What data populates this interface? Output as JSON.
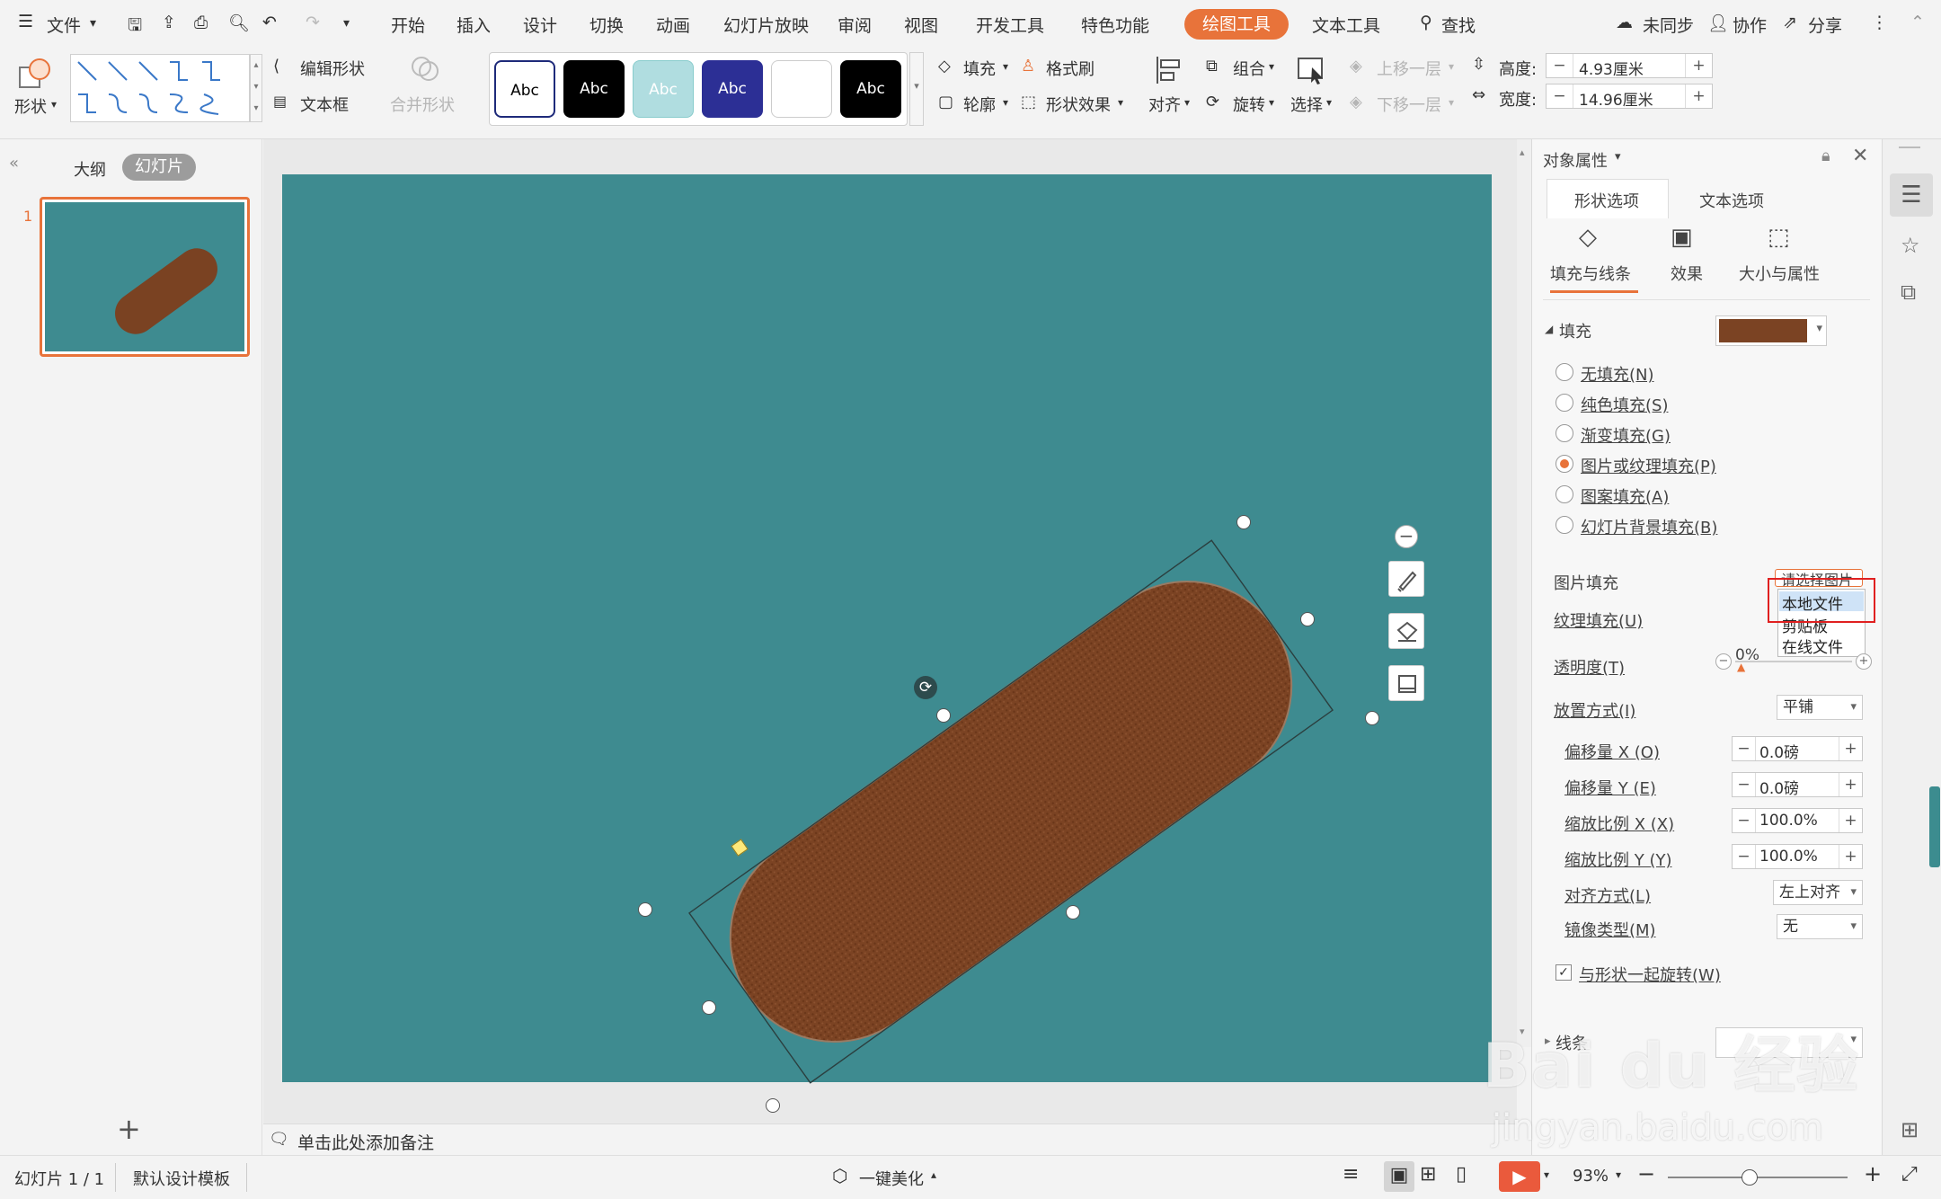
{
  "menubar": {
    "file": "文件",
    "tabs": [
      "开始",
      "插入",
      "设计",
      "切换",
      "动画",
      "幻灯片放映",
      "审阅",
      "视图",
      "开发工具",
      "特色功能"
    ],
    "active_tab": "绘图工具",
    "text_tools": "文本工具",
    "search": "查找",
    "sync": "未同步",
    "collab": "协作",
    "share": "分享"
  },
  "ribbon": {
    "shape": "形状",
    "edit_shape": "编辑形状",
    "text_box": "文本框",
    "merge_shape": "合并形状",
    "style_label": "Abc",
    "fill": "填充",
    "format_brush": "格式刷",
    "outline": "轮廓",
    "shape_effect": "形状效果",
    "align": "对齐",
    "group": "组合",
    "rotate": "旋转",
    "select": "选择",
    "up_layer": "上移一层",
    "down_layer": "下移一层",
    "height_label": "高度:",
    "height_value": "4.93厘米",
    "width_label": "宽度:",
    "width_value": "14.96厘米"
  },
  "left_panel": {
    "tab_outline": "大纲",
    "tab_slides": "幻灯片",
    "slide_number": "1"
  },
  "notes_hint": "单击此处添加备注",
  "right_panel": {
    "title": "对象属性",
    "tab_shape": "形状选项",
    "tab_text": "文本选项",
    "sub_fill": "填充与线条",
    "sub_effect": "效果",
    "sub_size": "大小与属性",
    "fill_section": "填充",
    "options": [
      "无填充(N)",
      "纯色填充(S)",
      "渐变填充(G)",
      "图片或纹理填充(P)",
      "图案填充(A)",
      "幻灯片背景填充(B)"
    ],
    "selected_option": "图片或纹理填充(P)",
    "picture_fill": "图片填充",
    "picture_fill_value": "请选择图片",
    "dropdown_items": [
      "本地文件",
      "剪贴板",
      "在线文件"
    ],
    "texture_fill": "纹理填充(U)",
    "transparency": "透明度(T)",
    "transparency_value": "0%",
    "placement": "放置方式(I)",
    "placement_value": "平铺",
    "offset_x": "偏移量 X (O)",
    "offset_x_value": "0.0磅",
    "offset_y": "偏移量 Y (E)",
    "offset_y_value": "0.0磅",
    "scale_x": "缩放比例 X (X)",
    "scale_x_value": "100.0%",
    "scale_y": "缩放比例 Y (Y)",
    "scale_y_value": "100.0%",
    "alignment": "对齐方式(L)",
    "alignment_value": "左上对齐",
    "mirror": "镜像类型(M)",
    "mirror_value": "无",
    "rotate_with_shape": "与形状一起旋转(W)",
    "line_section": "线条"
  },
  "status": {
    "slide_info": "幻灯片 1 / 1",
    "template": "默认设计模板",
    "beautify": "一键美化",
    "zoom": "93%"
  },
  "watermark": {
    "text": "Bai du 经验",
    "url": "jingyan.baidu.com"
  },
  "colors": {
    "accent": "#e8733a",
    "slide_bg": "#3e8b90",
    "shape_fill": "#7a4222"
  }
}
